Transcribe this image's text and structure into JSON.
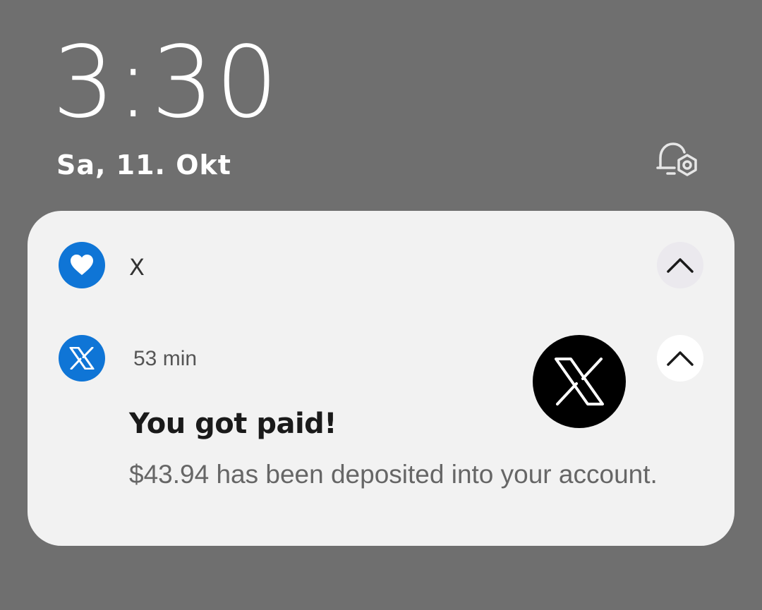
{
  "lockscreen": {
    "time": "3:30",
    "date": "Sa, 11. Okt"
  },
  "icons": {
    "notification_settings": "bell-settings-icon",
    "group_app": "heart-icon",
    "notification_app": "x-logo-icon",
    "collapse": "chevron-up-icon"
  },
  "notification_group": {
    "app_name": "X"
  },
  "notification": {
    "time_ago": "53 min",
    "title": "You got paid!",
    "body": "$43.94 has been deposited into your account."
  },
  "colors": {
    "background": "#6f6f6f",
    "card": "#f2f2f2",
    "app_icon_blue": "#0f75d6"
  }
}
